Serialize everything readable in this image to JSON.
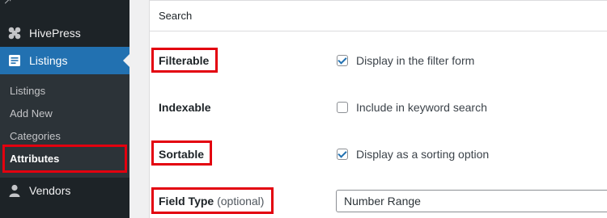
{
  "sidebar": {
    "menu": [
      {
        "label": "HivePress",
        "icon": "hivepress-icon"
      },
      {
        "label": "Listings",
        "icon": "listings-icon",
        "active": true
      },
      {
        "label": "Vendors",
        "icon": "vendors-icon"
      }
    ],
    "submenu": [
      "Listings",
      "Add New",
      "Categories",
      "Attributes"
    ]
  },
  "panel": {
    "title": "Search",
    "fields": {
      "filterable": {
        "label": "Filterable",
        "option": "Display in the filter form",
        "checked": true
      },
      "indexable": {
        "label": "Indexable",
        "option": "Include in keyword search",
        "checked": false
      },
      "sortable": {
        "label": "Sortable",
        "option": "Display as a sorting option",
        "checked": true
      },
      "field_type": {
        "label": "Field Type",
        "optional": "(optional)",
        "value": "Number Range"
      }
    }
  },
  "colors": {
    "sidebar_bg": "#1d2327",
    "submenu_bg": "#2c3338",
    "accent": "#2271b1",
    "highlight": "#e3000f"
  }
}
